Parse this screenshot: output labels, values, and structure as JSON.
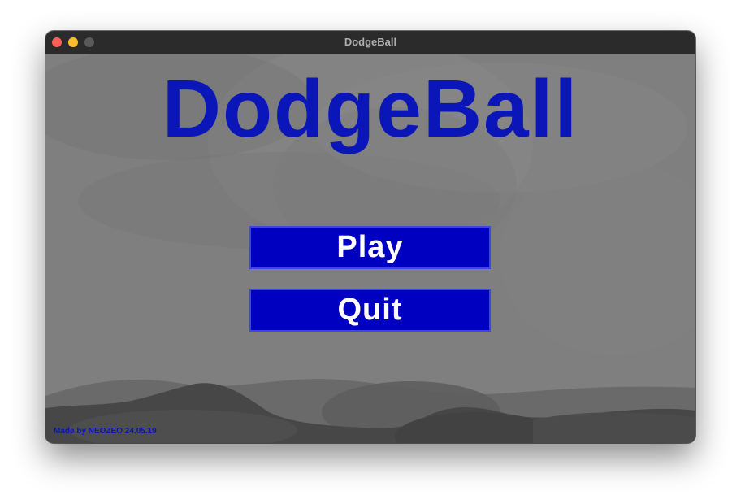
{
  "window": {
    "title": "DodgeBall",
    "controls": [
      "close",
      "minimize",
      "maximize"
    ]
  },
  "game": {
    "title": "DodgeBall",
    "buttons": {
      "play_label": "Play",
      "quit_label": "Quit"
    },
    "credits": "Made by NEOZEO 24.05.19"
  },
  "colors": {
    "title_blue": "#0a16b8",
    "button_fill": "#0000c0",
    "button_border": "#3b46e6",
    "button_text": "#ffffff",
    "background_gray": "#7f7f7f",
    "hills_dark": "#474747"
  }
}
